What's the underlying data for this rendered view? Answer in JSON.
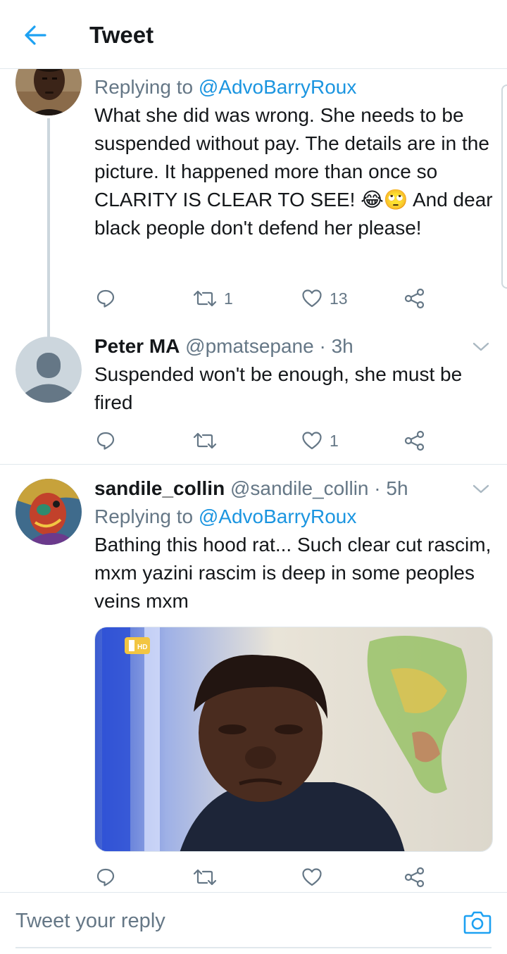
{
  "header": {
    "title": "Tweet"
  },
  "tweets": [
    {
      "reply_prefix": "Replying to ",
      "reply_mention": "@AdvoBarryRoux",
      "text": "What she did was wrong. She needs to be suspended without pay. The details are in the picture. It happened more than once so CLARITY IS CLEAR TO SEE! 😂🙄 And dear black people don't defend her please!",
      "retweets": "1",
      "likes": "13"
    },
    {
      "name": "Peter MA",
      "handle": "@pmatsepane",
      "time": "· 3h",
      "text": "Suspended won't be enough, she must be fired",
      "retweets": "",
      "likes": "1"
    },
    {
      "name": "sandile_collin",
      "handle": "@sandile_collin",
      "time": "· 5h",
      "reply_prefix": "Replying to ",
      "reply_mention": "@AdvoBarryRoux",
      "text": "Bathing this hood rat... Such clear cut rascim, mxm yazini rascim is deep in some peoples veins mxm",
      "retweets": "",
      "likes": "",
      "media_badge": "HD"
    }
  ],
  "reply_bar": {
    "placeholder": "Tweet your reply"
  },
  "icons": {
    "back": "arrow-left-icon",
    "reply": "speech-bubble-icon",
    "retweet": "retweet-icon",
    "like": "heart-icon",
    "share": "share-icon",
    "chevron": "chevron-down-icon",
    "camera": "camera-icon"
  },
  "colors": {
    "accent": "#1da1f2",
    "link": "#1b95e0",
    "secondary": "#657786",
    "divider": "#e1e8ed"
  }
}
